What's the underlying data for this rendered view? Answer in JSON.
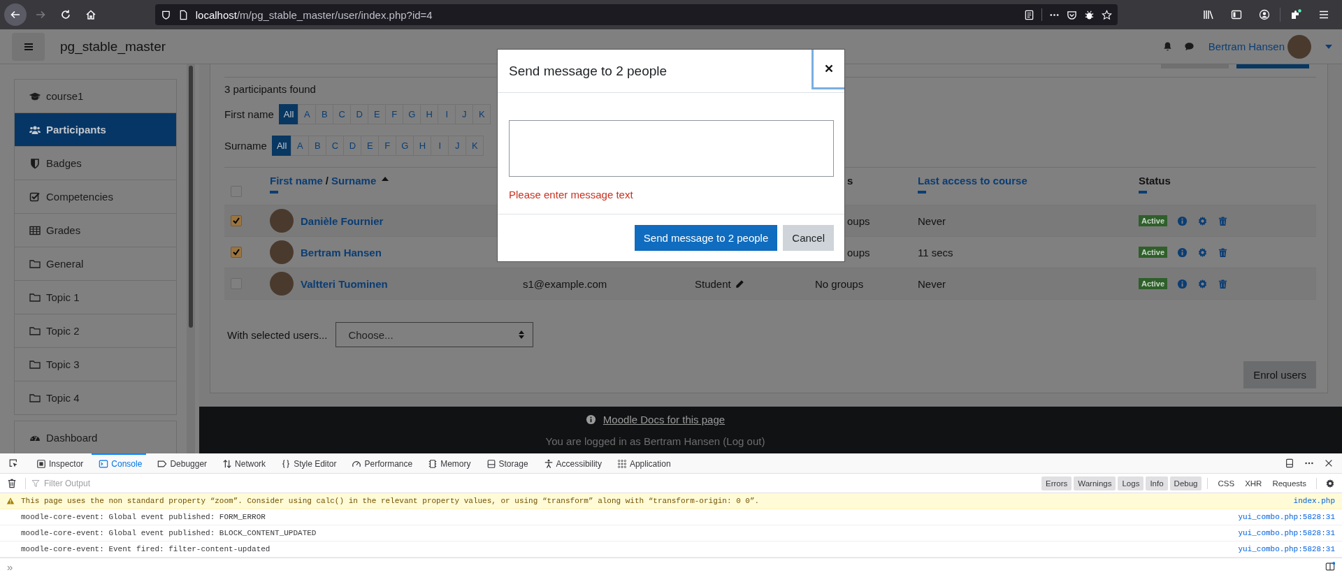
{
  "browser": {
    "url_host": "localhost",
    "url_path": "/m/pg_stable_master/user/index.php?id=4",
    "forward_disabled": true
  },
  "navbar": {
    "site_name": "pg_stable_master",
    "user_name": "Bertram Hansen"
  },
  "sidebar": {
    "groups": [
      {
        "items": [
          {
            "label": "course1",
            "kind": "course",
            "selected": false
          },
          {
            "label": "Participants",
            "kind": "participants",
            "selected": true
          },
          {
            "label": "Badges",
            "kind": "badges",
            "selected": false
          },
          {
            "label": "Competencies",
            "kind": "competencies",
            "selected": false
          },
          {
            "label": "Grades",
            "kind": "grades",
            "selected": false
          },
          {
            "label": "General",
            "kind": "folder",
            "selected": false
          },
          {
            "label": "Topic 1",
            "kind": "folder",
            "selected": false
          },
          {
            "label": "Topic 2",
            "kind": "folder",
            "selected": false
          },
          {
            "label": "Topic 3",
            "kind": "folder",
            "selected": false
          },
          {
            "label": "Topic 4",
            "kind": "folder",
            "selected": false
          }
        ]
      },
      {
        "items": [
          {
            "label": "Dashboard",
            "kind": "dashboard",
            "selected": false
          }
        ]
      }
    ]
  },
  "participants": {
    "count_text": "3 participants found",
    "filters": [
      {
        "label": "First name",
        "letters": [
          {
            "text": "All",
            "selected": true
          },
          {
            "text": "A",
            "selected": false
          },
          {
            "text": "B",
            "selected": false
          },
          {
            "text": "C",
            "selected": false
          },
          {
            "text": "D",
            "selected": false
          },
          {
            "text": "E",
            "selected": false
          },
          {
            "text": "F",
            "selected": false
          },
          {
            "text": "G",
            "selected": false
          },
          {
            "text": "H",
            "selected": false
          },
          {
            "text": "I",
            "selected": false
          },
          {
            "text": "J",
            "selected": false
          },
          {
            "text": "K",
            "selected": false
          }
        ]
      },
      {
        "label": "Surname",
        "letters": [
          {
            "text": "All",
            "selected": true
          },
          {
            "text": "A",
            "selected": false
          },
          {
            "text": "B",
            "selected": false
          },
          {
            "text": "C",
            "selected": false
          },
          {
            "text": "D",
            "selected": false
          },
          {
            "text": "E",
            "selected": false
          },
          {
            "text": "F",
            "selected": false
          },
          {
            "text": "G",
            "selected": false
          },
          {
            "text": "H",
            "selected": false
          },
          {
            "text": "I",
            "selected": false
          },
          {
            "text": "J",
            "selected": false
          },
          {
            "text": "K",
            "selected": false
          }
        ]
      }
    ],
    "table": {
      "columns": [
        {
          "kind": "select",
          "checked": false
        },
        {
          "kind": "name",
          "first": "First name",
          "separator": "/",
          "last": "Surname",
          "sort_ascending": true,
          "collapsible": true
        },
        {
          "kind": "blank"
        },
        {
          "kind": "blank"
        },
        {
          "kind": "text",
          "label": "s",
          "cut": true
        },
        {
          "kind": "link",
          "label": "Last access to course",
          "collapsible": true
        },
        {
          "kind": "text",
          "label": "Status",
          "collapsible": true
        }
      ],
      "rows": [
        {
          "checked": true,
          "name": "Danièle Fournier",
          "groups": "oups",
          "groups_cut": true,
          "last_access": "Never",
          "status": "Active"
        },
        {
          "checked": true,
          "name": "Bertram Hansen",
          "groups": "oups",
          "groups_cut": true,
          "last_access": "11 secs",
          "status": "Active"
        },
        {
          "checked": false,
          "name": "Valtteri Tuominen",
          "email": "s1@example.com",
          "role": "Student",
          "groups": "No groups",
          "last_access": "Never",
          "status": "Active"
        }
      ]
    },
    "bulk_label": "With selected users...",
    "bulk_select": "Choose...",
    "enrol_button": "Enrol users"
  },
  "modal": {
    "title": "Send message to 2 people",
    "close_focused": true,
    "error": "Please enter message text",
    "send_button": "Send message to 2 people",
    "cancel_button": "Cancel"
  },
  "footer": {
    "docs_link": "Moodle Docs for this page",
    "login_text": "You are logged in as Bertram Hansen (Log out)"
  },
  "devtools": {
    "tabs": [
      {
        "label": "Inspector",
        "kind": "inspector",
        "selected": false
      },
      {
        "label": "Console",
        "kind": "console",
        "selected": true
      },
      {
        "label": "Debugger",
        "kind": "debugger",
        "selected": false
      },
      {
        "label": "Network",
        "kind": "network",
        "selected": false
      },
      {
        "label": "Style Editor",
        "kind": "style",
        "selected": false
      },
      {
        "label": "Performance",
        "kind": "performance",
        "selected": false
      },
      {
        "label": "Memory",
        "kind": "memory",
        "selected": false
      },
      {
        "label": "Storage",
        "kind": "storage",
        "selected": false
      },
      {
        "label": "Accessibility",
        "kind": "accessibility",
        "selected": false
      },
      {
        "label": "Application",
        "kind": "application",
        "selected": false
      }
    ],
    "filter_placeholder": "Filter Output",
    "levels": [
      {
        "label": "Errors",
        "on": true
      },
      {
        "label": "Warnings",
        "on": true
      },
      {
        "label": "Logs",
        "on": true
      },
      {
        "label": "Info",
        "on": true
      },
      {
        "label": "Debug",
        "on": true
      }
    ],
    "types": [
      {
        "label": "CSS",
        "on": false
      },
      {
        "label": "XHR",
        "on": false
      },
      {
        "label": "Requests",
        "on": false
      }
    ],
    "messages": [
      {
        "kind": "warning",
        "text": "This page uses the non standard property “zoom”. Consider using calc() in the relevant property values, or using “transform” along with “transform-origin: 0 0”.",
        "source": "index.php"
      },
      {
        "kind": "log",
        "text": "moodle-core-event: Global event published: FORM_ERROR",
        "source": "yui_combo.php:5828:31"
      },
      {
        "kind": "log",
        "text": "moodle-core-event: Global event published: BLOCK_CONTENT_UPDATED",
        "source": "yui_combo.php:5828:31"
      },
      {
        "kind": "log",
        "text": "moodle-core-event: Event fired: filter-content-updated",
        "source": "yui_combo.php:5828:31"
      }
    ],
    "prompt": "»"
  }
}
